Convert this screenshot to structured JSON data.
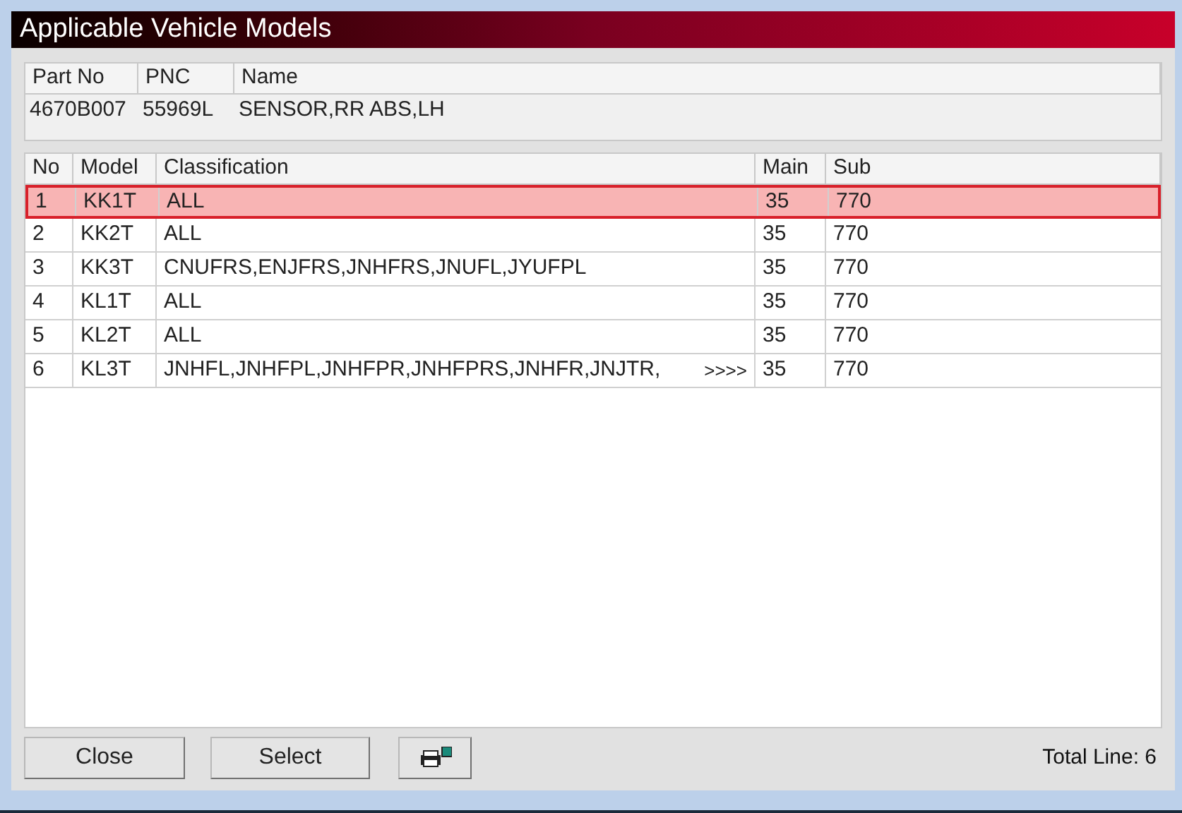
{
  "window": {
    "title": "Applicable Vehicle Models"
  },
  "part": {
    "columns": [
      "Part No",
      "PNC",
      "Name"
    ],
    "values": [
      "4670B007",
      "55969L",
      "SENSOR,RR ABS,LH"
    ]
  },
  "table": {
    "columns": [
      "No",
      "Model",
      "Classification",
      "Main",
      "Sub"
    ],
    "rows": [
      {
        "cells": [
          "1",
          "KK1T",
          "ALL",
          "35",
          "770"
        ],
        "selected": true
      },
      {
        "cells": [
          "2",
          "KK2T",
          "ALL",
          "35",
          "770"
        ],
        "selected": false
      },
      {
        "cells": [
          "3",
          "KK3T",
          "CNUFRS,ENJFRS,JNHFRS,JNUFL,JYUFPL",
          "35",
          "770"
        ],
        "selected": false
      },
      {
        "cells": [
          "4",
          "KL1T",
          "ALL",
          "35",
          "770"
        ],
        "selected": false
      },
      {
        "cells": [
          "5",
          "KL2T",
          "ALL",
          "35",
          "770"
        ],
        "selected": false
      },
      {
        "cells": [
          "6",
          "KL3T",
          "JNHFL,JNHFPL,JNHFPR,JNHFPRS,JNHFR,JNJTR,",
          "35",
          "770"
        ],
        "selected": false,
        "more": ">>>>"
      }
    ]
  },
  "buttons": [
    "Close",
    "Select"
  ],
  "total": "Total Line: 6"
}
